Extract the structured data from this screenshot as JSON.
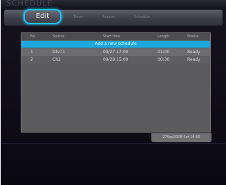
{
  "title": "SCHEDULE",
  "tabs": [
    {
      "label": "Edit",
      "selected": true
    },
    {
      "label": "Timer"
    },
    {
      "label": "Repeat"
    },
    {
      "label": "Schedule"
    }
  ],
  "table": {
    "headers": [
      "No",
      "Source",
      "Start time",
      "Length",
      "Status"
    ],
    "add_row_label": "Add a new schedule",
    "rows": [
      {
        "no": "1",
        "source": "Dtv71",
        "start": "09/27 17:00",
        "length": "01:00",
        "status": "Ready"
      },
      {
        "no": "2",
        "source": "Ch2",
        "start": "09/28 15:00",
        "length": "00:30",
        "status": "Ready"
      }
    ]
  },
  "clock": "27Sep2008 Sat 16:55",
  "colors": {
    "accent": "#18c8ff",
    "highlight_row": "#1ba9df",
    "panel": "#5b5b5d",
    "background": "#0a0810"
  }
}
